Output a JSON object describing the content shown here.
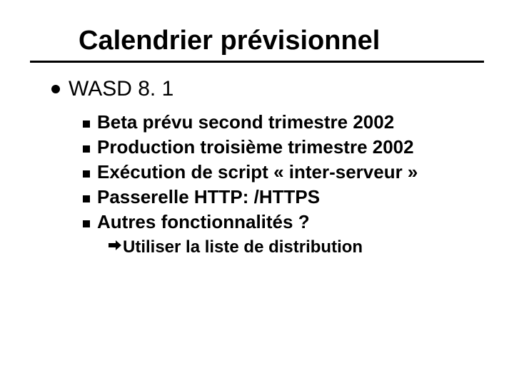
{
  "title": "Calendrier prévisionnel",
  "level1": {
    "text": "WASD 8. 1"
  },
  "level2": [
    {
      "text": "Beta prévu second trimestre 2002"
    },
    {
      "text": "Production troisième trimestre 2002"
    },
    {
      "text": "Exécution de script « inter-serveur »"
    },
    {
      "text": "Passerelle HTTP: /HTTPS"
    },
    {
      "text": "Autres fonctionnalités ?"
    }
  ],
  "level3": {
    "text": "Utiliser la liste de distribution"
  }
}
